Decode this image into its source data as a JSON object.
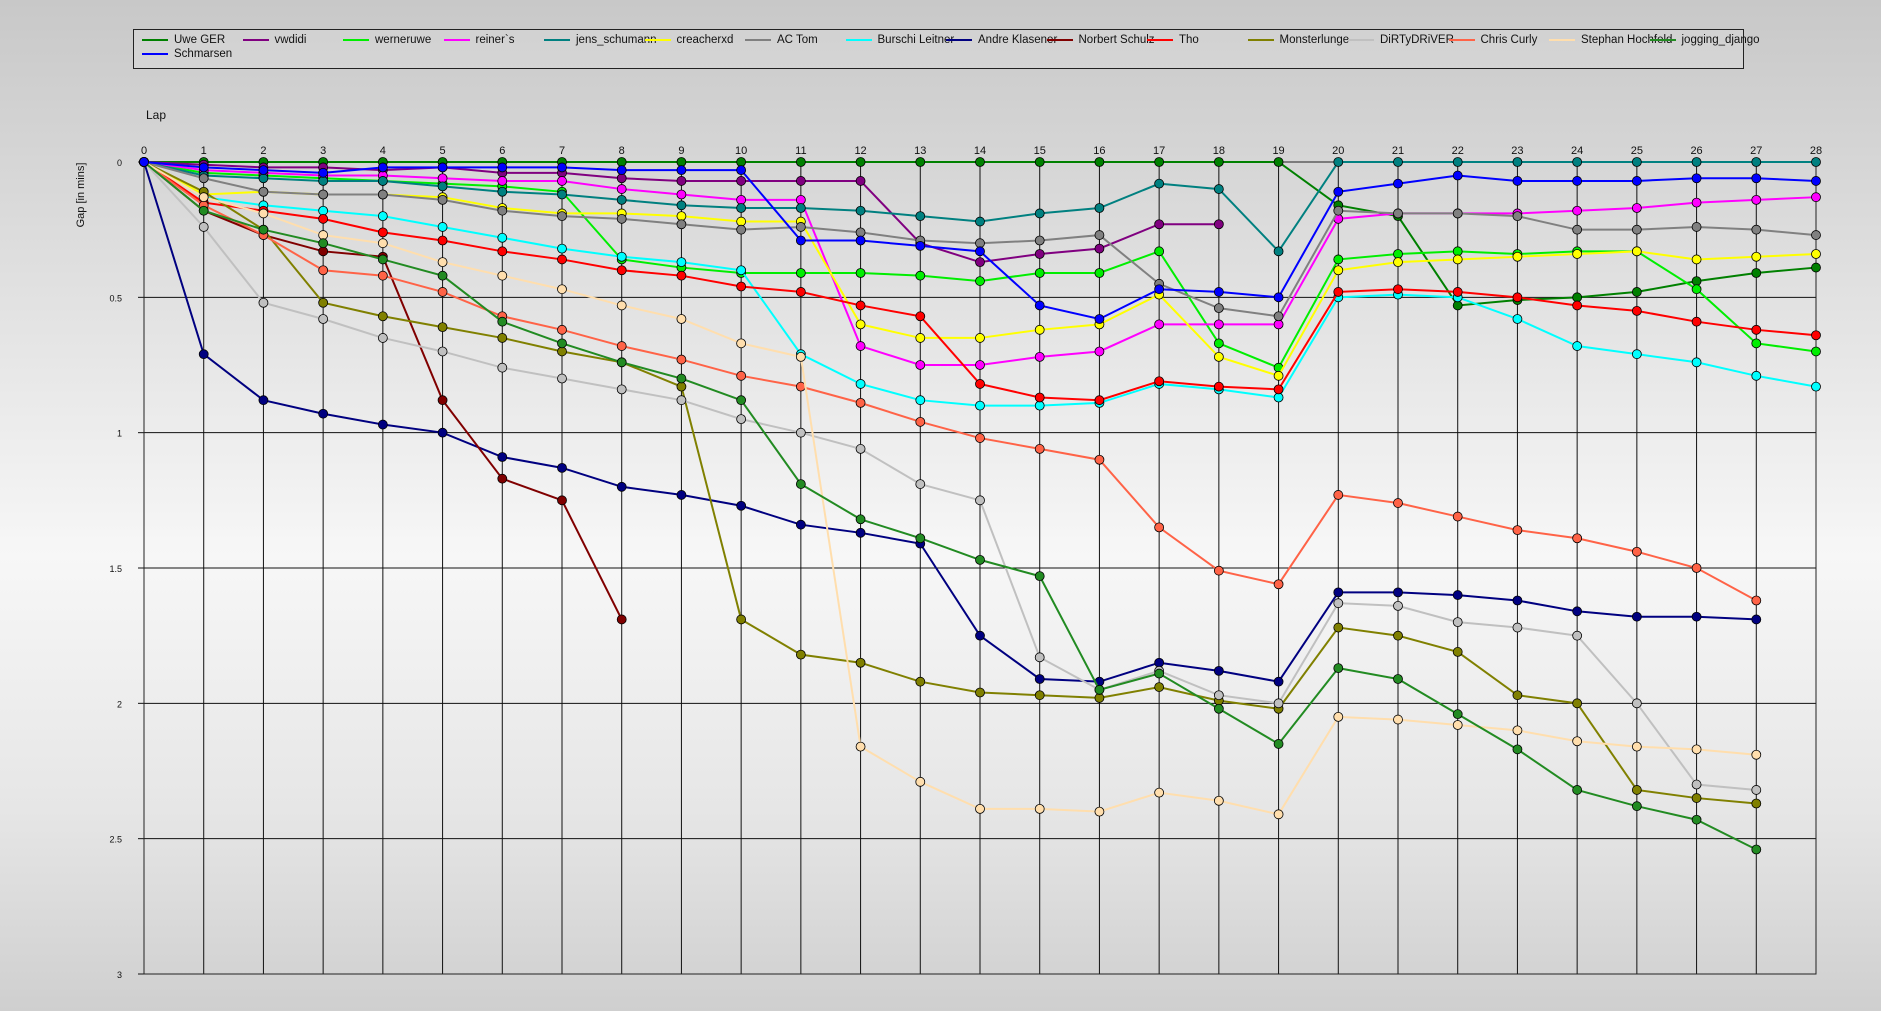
{
  "chart_data": {
    "type": "line",
    "xlabel": "Lap",
    "ylabel": "Gap [in mins]",
    "xlim": [
      0,
      28
    ],
    "ylim": [
      0,
      3
    ],
    "y_inverted": true,
    "grid": true,
    "legend_placement": "top",
    "x_ticks": [
      "0",
      "1",
      "2",
      "3",
      "4",
      "5",
      "6",
      "7",
      "8",
      "9",
      "10",
      "11",
      "12",
      "13",
      "14",
      "15",
      "16",
      "17",
      "18",
      "19",
      "20",
      "21",
      "22",
      "23",
      "24",
      "25",
      "26",
      "27",
      "28"
    ],
    "y_ticks": [
      "0",
      "0.5",
      "1",
      "1.5",
      "2",
      "2.5",
      "3"
    ],
    "series": [
      {
        "name": "Uwe GER",
        "color": "#008000",
        "values": [
          0,
          0,
          0,
          0,
          0,
          0,
          0,
          0,
          0,
          0,
          0,
          0,
          0,
          0,
          0,
          0,
          0,
          0,
          0,
          0,
          0.16,
          0.2,
          0.53,
          0.51,
          0.5,
          0.48,
          0.44,
          0.41,
          0.39
        ]
      },
      {
        "name": "vwdidi",
        "color": "#800080",
        "values": [
          0,
          0.01,
          0.02,
          0.02,
          0.03,
          0.02,
          0.04,
          0.04,
          0.06,
          0.07,
          0.07,
          0.07,
          0.07,
          0.3,
          0.37,
          0.34,
          0.32,
          0.23,
          0.23,
          null,
          null,
          null,
          null,
          null,
          null,
          null,
          null,
          null,
          null
        ]
      },
      {
        "name": "werneruwe",
        "color": "#00ee00",
        "values": [
          0,
          0.04,
          0.05,
          0.06,
          0.07,
          0.08,
          0.09,
          0.11,
          0.36,
          0.39,
          0.41,
          0.41,
          0.41,
          0.42,
          0.44,
          0.41,
          0.41,
          0.33,
          0.67,
          0.76,
          0.36,
          0.34,
          0.33,
          0.34,
          0.33,
          0.33,
          0.47,
          0.67,
          0.7
        ]
      },
      {
        "name": "reiner`s",
        "color": "#ff00ff",
        "values": [
          0,
          0.03,
          0.04,
          0.05,
          0.05,
          0.06,
          0.07,
          0.07,
          0.1,
          0.12,
          0.14,
          0.14,
          0.68,
          0.75,
          0.75,
          0.72,
          0.7,
          0.6,
          0.6,
          0.6,
          0.21,
          0.19,
          0.19,
          0.19,
          0.18,
          0.17,
          0.15,
          0.14,
          0.13
        ]
      },
      {
        "name": "jens_schumann",
        "color": "#008080",
        "values": [
          0,
          0.05,
          0.06,
          0.07,
          0.07,
          0.09,
          0.11,
          0.12,
          0.14,
          0.16,
          0.17,
          0.17,
          0.18,
          0.2,
          0.22,
          0.19,
          0.17,
          0.08,
          0.1,
          0.33,
          0,
          0,
          0,
          0,
          0,
          0,
          0,
          0,
          0
        ]
      },
      {
        "name": "creacherxd",
        "color": "#ffff00",
        "values": [
          0,
          0.12,
          0.11,
          0.12,
          0.12,
          0.13,
          0.17,
          0.19,
          0.19,
          0.2,
          0.22,
          0.22,
          0.6,
          0.65,
          0.65,
          0.62,
          0.6,
          0.49,
          0.72,
          0.79,
          0.4,
          0.37,
          0.36,
          0.35,
          0.34,
          0.33,
          0.36,
          0.35,
          0.34
        ]
      },
      {
        "name": "AC Tom",
        "color": "#808080",
        "values": [
          0,
          0.06,
          0.11,
          0.12,
          0.12,
          0.14,
          0.18,
          0.2,
          0.21,
          0.23,
          0.25,
          0.24,
          0.26,
          0.29,
          0.3,
          0.29,
          0.27,
          0.45,
          0.54,
          0.57,
          0.18,
          0.19,
          0.19,
          0.2,
          0.25,
          0.25,
          0.24,
          0.25,
          0.27
        ]
      },
      {
        "name": "Burschi Leitner",
        "color": "#00ffff",
        "values": [
          0,
          0.13,
          0.16,
          0.18,
          0.2,
          0.24,
          0.28,
          0.32,
          0.35,
          0.37,
          0.4,
          0.71,
          0.82,
          0.88,
          0.9,
          0.9,
          0.89,
          0.82,
          0.84,
          0.87,
          0.5,
          0.49,
          0.5,
          0.58,
          0.68,
          0.71,
          0.74,
          0.79,
          0.83
        ]
      },
      {
        "name": "Andre Klasener",
        "color": "#000080",
        "values": [
          0,
          0.71,
          0.88,
          0.93,
          0.97,
          1,
          1.09,
          1.13,
          1.2,
          1.23,
          1.27,
          1.34,
          1.37,
          1.41,
          1.75,
          1.91,
          1.92,
          1.85,
          1.88,
          1.92,
          1.59,
          1.59,
          1.6,
          1.62,
          1.66,
          1.68,
          1.68,
          1.69,
          null
        ]
      },
      {
        "name": "Norbert Schulz",
        "color": "#800000",
        "values": [
          0,
          0.18,
          0.27,
          0.33,
          0.35,
          0.88,
          1.17,
          1.25,
          1.69,
          null,
          null,
          null,
          null,
          null,
          null,
          null,
          null,
          null,
          null,
          null,
          null,
          null,
          null,
          null,
          null,
          null,
          null,
          null,
          null
        ]
      },
      {
        "name": "Tho",
        "color": "#ff0000",
        "values": [
          0,
          0.15,
          0.18,
          0.21,
          0.26,
          0.29,
          0.33,
          0.36,
          0.4,
          0.42,
          0.46,
          0.48,
          0.53,
          0.57,
          0.82,
          0.87,
          0.88,
          0.81,
          0.83,
          0.84,
          0.48,
          0.47,
          0.48,
          0.5,
          0.53,
          0.55,
          0.59,
          0.62,
          0.64
        ]
      },
      {
        "name": "Monsterlunge",
        "color": "#808000",
        "values": [
          0,
          0.11,
          0.25,
          0.52,
          0.57,
          0.61,
          0.65,
          0.7,
          0.74,
          0.83,
          1.69,
          1.82,
          1.85,
          1.92,
          1.96,
          1.97,
          1.98,
          1.94,
          1.99,
          2.02,
          1.72,
          1.75,
          1.81,
          1.97,
          2,
          2.32,
          2.35,
          2.37,
          null
        ]
      },
      {
        "name": "DiRTyDRiVER",
        "color": "#c0c0c0",
        "values": [
          0,
          0.24,
          0.52,
          0.58,
          0.65,
          0.7,
          0.76,
          0.8,
          0.84,
          0.88,
          0.95,
          1,
          1.06,
          1.19,
          1.25,
          1.83,
          1.95,
          1.88,
          1.97,
          2,
          1.63,
          1.64,
          1.7,
          1.72,
          1.75,
          2,
          2.3,
          2.32,
          null
        ]
      },
      {
        "name": "Chris Curly",
        "color": "#ff6347",
        "values": [
          0,
          0.16,
          0.27,
          0.4,
          0.42,
          0.48,
          0.57,
          0.62,
          0.68,
          0.73,
          0.79,
          0.83,
          0.89,
          0.96,
          1.02,
          1.06,
          1.1,
          1.35,
          1.51,
          1.56,
          1.23,
          1.26,
          1.31,
          1.36,
          1.39,
          1.44,
          1.5,
          1.62,
          null
        ]
      },
      {
        "name": "Stephan Hochfeld",
        "color": "#ffdead",
        "values": [
          0,
          0.13,
          0.19,
          0.27,
          0.3,
          0.37,
          0.42,
          0.47,
          0.53,
          0.58,
          0.67,
          0.72,
          2.16,
          2.29,
          2.39,
          2.39,
          2.4,
          2.33,
          2.36,
          2.41,
          2.05,
          2.06,
          2.08,
          2.1,
          2.14,
          2.16,
          2.17,
          2.19,
          null
        ]
      },
      {
        "name": "jogging_django",
        "color": "#228b22",
        "values": [
          0,
          0.18,
          0.25,
          0.3,
          0.36,
          0.42,
          0.59,
          0.67,
          0.74,
          0.8,
          0.88,
          1.19,
          1.32,
          1.39,
          1.47,
          1.53,
          1.95,
          1.89,
          2.02,
          2.15,
          1.87,
          1.91,
          2.04,
          2.17,
          2.32,
          2.38,
          2.43,
          2.54,
          null
        ]
      },
      {
        "name": "Schmarsen",
        "color": "#0000ff",
        "values": [
          0,
          0.02,
          0.03,
          0.04,
          0.02,
          0.02,
          0.02,
          0.02,
          0.03,
          0.03,
          0.03,
          0.29,
          0.29,
          0.31,
          0.33,
          0.53,
          0.58,
          0.47,
          0.48,
          0.5,
          0.11,
          0.08,
          0.05,
          0.07,
          0.07,
          0.07,
          0.06,
          0.06,
          0.07
        ]
      }
    ]
  }
}
